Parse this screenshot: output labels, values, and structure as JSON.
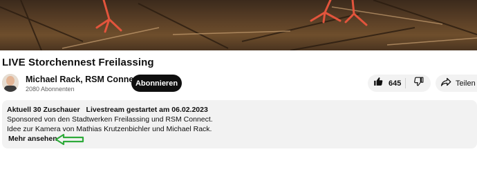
{
  "video": {
    "description": "livestream"
  },
  "title": "LIVE Storchennest Freilassing",
  "channel": {
    "name": "Michael Rack, RSM Connect",
    "subscribers": "2080 Abonnenten",
    "subscribe_label": "Abonnieren"
  },
  "actions": {
    "like_count": "645",
    "share_label": "Teilen"
  },
  "description": {
    "viewers": "Aktuell 30 Zuschauer",
    "started": "Livestream gestartet am 06.02.2023",
    "line1": "Sponsored von den Stadtwerken Freilassing und RSM Connect.",
    "line2": "Idee zur Kamera von Mathias Krutzenbichler und Michael Rack.",
    "more_label": "Mehr ansehen"
  },
  "colors": {
    "subscribe_bg": "#0f0f0f",
    "pill_bg": "#f2f2f2",
    "annotation_arrow": "#2eaa3a"
  },
  "icons": [
    "thumbs-up-icon",
    "thumbs-down-icon",
    "share-arrow-icon",
    "annotation-arrow-icon"
  ]
}
